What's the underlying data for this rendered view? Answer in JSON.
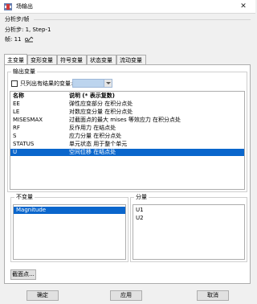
{
  "window": {
    "title": "场输出",
    "close_symbol": "✕"
  },
  "step_info": {
    "group_title": "分析步/帧",
    "step_line": "分析步: 1, Step-1",
    "frame_line": "帧:  11"
  },
  "tabs": [
    {
      "label": "主变量",
      "active": true
    },
    {
      "label": "变形变量"
    },
    {
      "label": "符号变量"
    },
    {
      "label": "状态变量"
    },
    {
      "label": "流动变量"
    }
  ],
  "output_variable": {
    "group_title": "输出变量",
    "checkbox_label": "只列出有结果的变量:",
    "checkbox_checked": false,
    "combo_value": "",
    "columns": {
      "name": "名称",
      "description": "说明 (* 表示复数)"
    },
    "rows": [
      {
        "name": "EE",
        "description": "弹性应变部分 在积分点处"
      },
      {
        "name": "LE",
        "description": "对数应变分量 在积分点处"
      },
      {
        "name": "MISESMAX",
        "description": "过截面点的最大 mises 等效应力 在积分点处"
      },
      {
        "name": "RF",
        "description": "反作用力 在结点处"
      },
      {
        "name": "S",
        "description": "应力分量 在积分点处"
      },
      {
        "name": "STATUS",
        "description": "单元状态 用于整个单元"
      },
      {
        "name": "U",
        "description": "空间位移 在结点处",
        "selected": true
      }
    ]
  },
  "invariant": {
    "group_title": "不变量",
    "items": [
      {
        "label": "Magnitude",
        "selected": true
      }
    ]
  },
  "component": {
    "group_title": "分量",
    "items": [
      {
        "label": "U1"
      },
      {
        "label": "U2"
      }
    ]
  },
  "section_points_button": "截面点...",
  "footer": {
    "ok": "确定",
    "apply": "应用",
    "cancel": "取消"
  },
  "colors": {
    "selection": "#0a66cc",
    "combo": "#bcd4ee"
  }
}
